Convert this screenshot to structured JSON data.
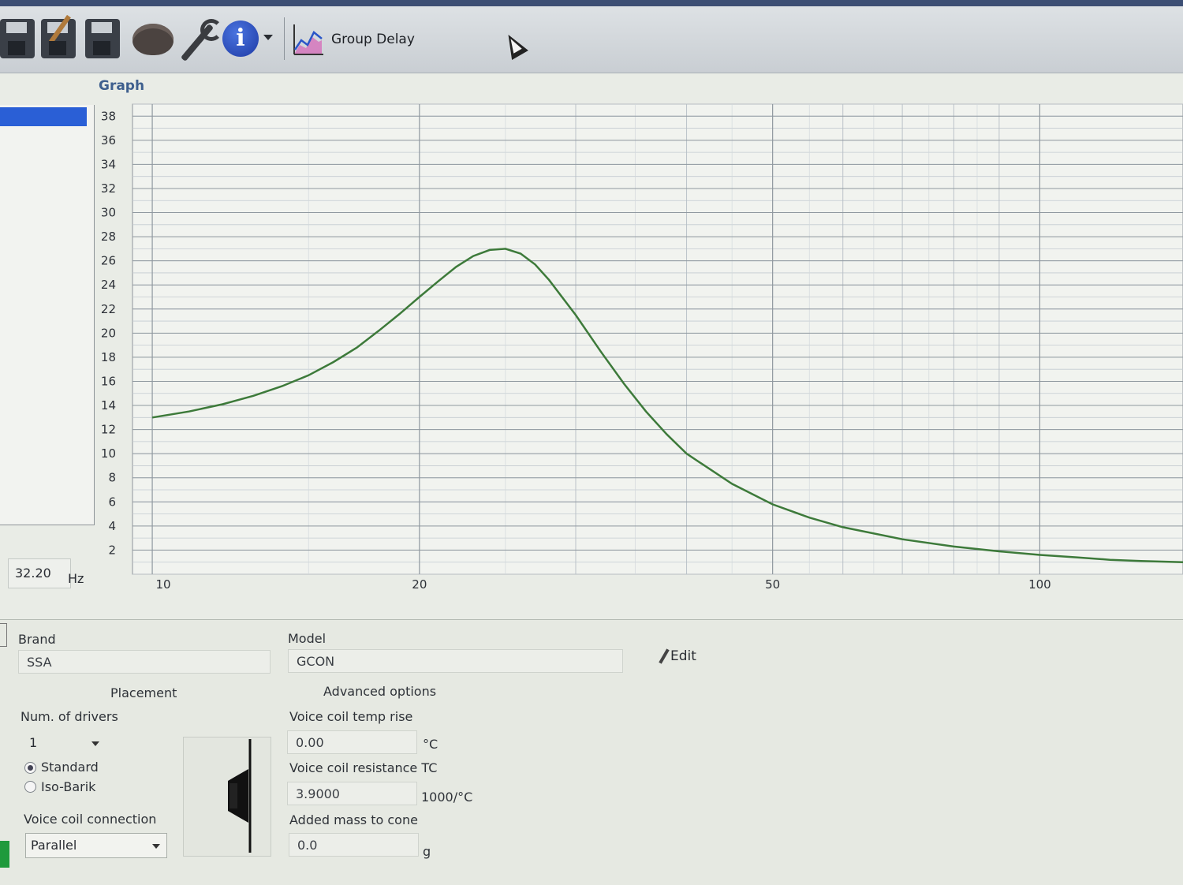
{
  "toolbar": {
    "icons": [
      "save-icon",
      "save-as-icon",
      "save-all-icon",
      "speaker-driver-icon",
      "wrench-icon",
      "info-icon",
      "chevron-down-icon",
      "group-delay-chart-icon"
    ],
    "group_delay_label": "Group Delay"
  },
  "graph": {
    "title": "Graph",
    "frequency_value": "32.20",
    "frequency_unit": "Hz"
  },
  "chart_data": {
    "type": "line",
    "x_scale": "log",
    "xlim": [
      9.5,
      145
    ],
    "ylim": [
      0,
      39
    ],
    "x_ticks": [
      10,
      20,
      50,
      100
    ],
    "y_ticks": [
      2,
      4,
      6,
      8,
      10,
      12,
      14,
      16,
      18,
      20,
      22,
      24,
      26,
      28,
      30,
      32,
      34,
      36,
      38
    ],
    "grid": true,
    "line_color": "#3d7a3a",
    "series": [
      {
        "x": [
          10,
          11,
          12,
          13,
          14,
          15,
          16,
          17,
          18,
          19,
          20,
          21,
          22,
          23,
          24,
          25,
          26,
          27,
          28,
          30,
          32,
          34,
          36,
          38,
          40,
          45,
          50,
          55,
          60,
          70,
          80,
          90,
          100,
          110,
          120,
          130,
          145
        ],
        "y": [
          13.0,
          13.5,
          14.1,
          14.8,
          15.6,
          16.5,
          17.6,
          18.8,
          20.2,
          21.6,
          23.0,
          24.3,
          25.5,
          26.4,
          26.9,
          27.0,
          26.6,
          25.7,
          24.4,
          21.5,
          18.5,
          15.8,
          13.5,
          11.6,
          10.0,
          7.5,
          5.8,
          4.7,
          3.9,
          2.9,
          2.3,
          1.9,
          1.6,
          1.4,
          1.2,
          1.1,
          1.0
        ]
      }
    ]
  },
  "driver": {
    "brand_label": "Brand",
    "brand_value": "SSA",
    "model_label": "Model",
    "model_value": "GCON",
    "edit_label": "Edit"
  },
  "placement": {
    "title": "Placement",
    "num_drivers_label": "Num. of drivers",
    "num_drivers_value": "1",
    "radio_standard": "Standard",
    "radio_isobarik": "Iso-Barik",
    "selected": "Standard",
    "voice_coil_connection_label": "Voice coil connection",
    "voice_coil_connection_value": "Parallel"
  },
  "advanced": {
    "title": "Advanced options",
    "temp_rise_label": "Voice coil temp rise",
    "temp_rise_value": "0.00",
    "temp_rise_unit": "°C",
    "resistance_tc_label": "Voice coil resistance TC",
    "resistance_tc_value": "3.9000",
    "resistance_tc_unit": "1000/°C",
    "added_mass_label": "Added mass to cone",
    "added_mass_value": "0.0",
    "added_mass_unit": "g"
  }
}
